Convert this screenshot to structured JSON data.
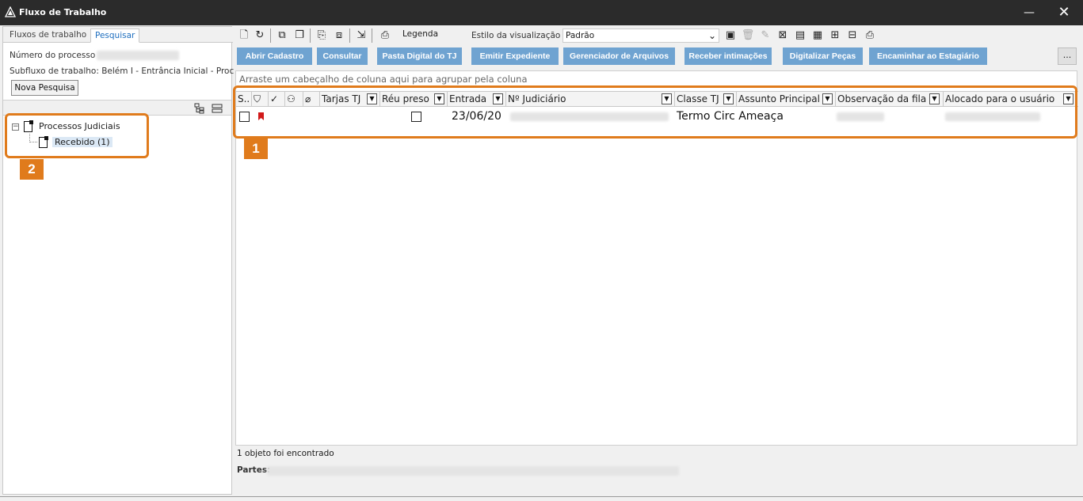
{
  "window": {
    "title": "Fluxo de Trabalho",
    "minimize_glyph": "—",
    "close_glyph": "✕"
  },
  "left": {
    "tabs": [
      "Fluxos de trabalho",
      "Pesquisar"
    ],
    "numero_label": "Número do processo",
    "subfluxo_label": "Subfluxo de trabalho: Belém I - Entrância Inicial - Proce",
    "nova_pesquisa": "Nova Pesquisa",
    "tree": {
      "root": "Processos Judiciais",
      "child": "Recebido (1)",
      "expander": "−"
    },
    "badge": "2"
  },
  "toolbar": {
    "legend_label": "Legenda",
    "estilo_label": "Estilo da visualização",
    "estilo_value": "Padrão"
  },
  "actions": [
    "Abrir Cadastro",
    "Consultar",
    "Pasta Digital do TJ",
    "Emitir Expediente",
    "Gerenciador de Arquivos",
    "Receber intimações",
    "Digitalizar Peças",
    "Encaminhar ao Estagiário"
  ],
  "more_label": "...",
  "grid": {
    "group_hint": "Arraste um cabeçalho de coluna aqui para agrupar pela coluna",
    "columns": {
      "s": "S..",
      "tarjas": "Tarjas TJ",
      "reu": "Réu preso",
      "entrada": "Entrada",
      "nj": "Nº Judiciário",
      "classe": "Classe TJ",
      "assunto": "Assunto Principal",
      "obs": "Observação da fila",
      "alocado": "Alocado para o usuário"
    },
    "row": {
      "entrada": "23/06/20",
      "classe": "Termo Circ Ameaça"
    },
    "badge": "1"
  },
  "status": {
    "count": "1 objeto foi encontrado",
    "partes_label": "Partes:"
  },
  "colors": {
    "accent_orange": "#e07b1c",
    "action_blue": "#6fa3d1",
    "titlebar": "#2b2b2b",
    "flag_red": "#d11a1a"
  }
}
